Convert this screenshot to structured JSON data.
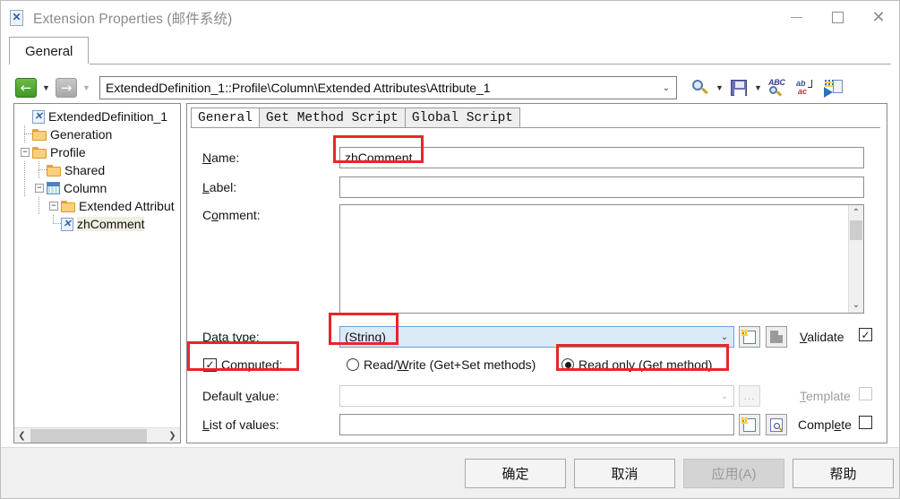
{
  "window": {
    "title": "Extension Properties (邮件系统)",
    "icon": "extension-document-icon",
    "controls": {
      "minimize": "–",
      "maximize": "□",
      "close": "✕"
    }
  },
  "outer_tab": {
    "label": "General"
  },
  "navbar": {
    "back_icon": "back-arrow-icon",
    "forward_icon": "forward-arrow-icon",
    "path_value": "ExtendedDefinition_1::Profile\\Column\\Extended Attributes\\Attribute_1",
    "path_caret": "⌄",
    "tools": [
      {
        "name": "find-icon",
        "label": "Find"
      },
      {
        "name": "save-icon",
        "label": "Save"
      },
      {
        "name": "spell-check-icon",
        "label": "Spell Check"
      },
      {
        "name": "replace-icon",
        "label": "Replace"
      },
      {
        "name": "export-icon",
        "label": "Export"
      }
    ]
  },
  "tree": {
    "nodes": [
      {
        "label": "ExtendedDefinition_1",
        "icon": "extension-document-icon",
        "indent": 0,
        "expander": "",
        "selected": false
      },
      {
        "label": "Generation",
        "icon": "folder-icon",
        "indent": 1,
        "expander": "",
        "selected": false
      },
      {
        "label": "Profile",
        "icon": "folder-icon",
        "indent": 1,
        "expander": "-",
        "selected": false
      },
      {
        "label": "Shared",
        "icon": "folder-icon",
        "indent": 2,
        "expander": "",
        "selected": false
      },
      {
        "label": "Column",
        "icon": "table-icon",
        "indent": 2,
        "expander": "-",
        "selected": false
      },
      {
        "label": "Extended Attribut",
        "icon": "folder-icon",
        "indent": 3,
        "expander": "-",
        "selected": false
      },
      {
        "label": "zhComment",
        "icon": "extension-document-icon",
        "indent": 4,
        "expander": "",
        "selected": true
      }
    ],
    "scroll_left_icon": "‹",
    "scroll_right_icon": "›"
  },
  "inner_tabs": [
    {
      "label": "General",
      "active": true
    },
    {
      "label": "Get Method Script",
      "active": false
    },
    {
      "label": "Global Script",
      "active": false
    }
  ],
  "form": {
    "name": {
      "label": "Name:",
      "accel": "N",
      "value": "zhComment"
    },
    "label_field": {
      "label": "Label:",
      "accel": "L",
      "value": ""
    },
    "comment": {
      "label": "Comment:",
      "accel": "o",
      "value": ""
    },
    "data_type": {
      "label": "Data type:",
      "accel": "t",
      "value": "(String)",
      "caret": "⌄"
    },
    "validate": {
      "label": "Validate",
      "accel": "V",
      "checked": true
    },
    "computed": {
      "label": "Computed:",
      "accel": "C",
      "checked": true
    },
    "read_write": {
      "label": "Read/Write (Get+Set methods)",
      "accel": "W",
      "selected": false
    },
    "read_only": {
      "label": "Read only (Get method)",
      "accel": "R",
      "selected": true
    },
    "default_value": {
      "label": "Default value:",
      "accel": "v",
      "value": "",
      "caret": "⌄",
      "ellipsis": "...",
      "disabled": true
    },
    "template": {
      "label": "Template",
      "accel": "T",
      "checked": false,
      "disabled": true
    },
    "list_of_values": {
      "label": "List of values:",
      "accel": "L",
      "value": ""
    },
    "complete": {
      "label": "Complete",
      "accel": "e",
      "checked": false
    }
  },
  "buttons": {
    "ok": "确定",
    "cancel": "取消",
    "apply": "应用(A)",
    "help": "帮助"
  },
  "annotations": {
    "color": "#e8262a",
    "boxes": [
      "name-value",
      "data-type-value",
      "computed-checkbox",
      "read-only-radio"
    ]
  }
}
